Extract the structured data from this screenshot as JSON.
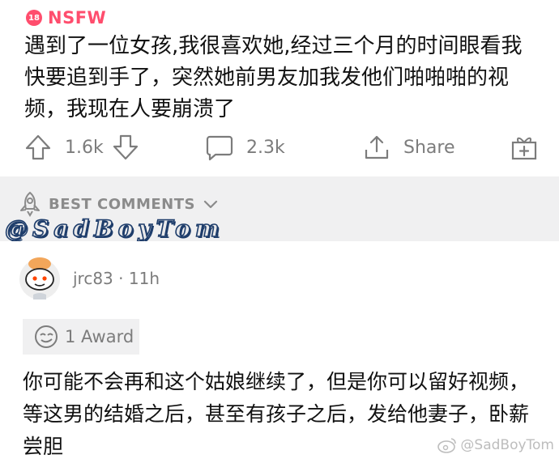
{
  "post": {
    "nsfw_badge": "18",
    "nsfw_label": "NSFW",
    "title": "遇到了一位女孩,我很喜欢她,经过三个月的时间眼看我快要追到手了，突然她前男友加我发他们啪啪啪的视频，我现在人要崩溃了",
    "upvotes": "1.6k",
    "comments": "2.3k",
    "share_label": "Share"
  },
  "sort": {
    "label": "BEST COMMENTS"
  },
  "watermark_handle": "@SadBoyTom",
  "comment": {
    "username": "jrc83",
    "separator": "·",
    "age": "11h",
    "award_label": "1 Award",
    "text": "你可能不会再和这个姑娘继续了，但是你可以留好视频，等这男的结婚之后，甚至有孩子之后，发给他妻子，卧薪尝胆"
  },
  "weibo_watermark": "@SadBoyTom",
  "colors": {
    "nsfw": "#ff4d6d",
    "muted": "#7c7c7c",
    "band": "#f0f0f1"
  }
}
